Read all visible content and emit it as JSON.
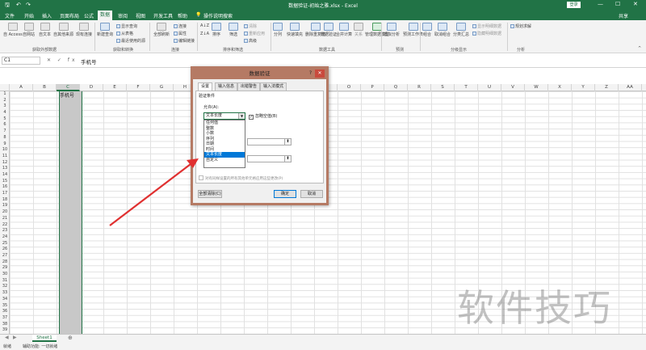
{
  "titlebar": {
    "title": "数据验证-初始之雅.xlsx  -  Excel",
    "login": "登录",
    "qa_save": "🖫",
    "qa_undo": "↶",
    "qa_redo": "↷",
    "win_min": "—",
    "win_max": "☐",
    "win_close": "✕"
  },
  "menu": {
    "tabs": [
      "文件",
      "开始",
      "插入",
      "页面布局",
      "公式",
      "数据",
      "审阅",
      "视图",
      "开发工具",
      "帮助",
      "操作说明搜索"
    ],
    "active": "数据",
    "share": "共享"
  },
  "ribbon": {
    "get_external": {
      "items": [
        "自 Access",
        "自网站",
        "自文本",
        "自其他来源",
        "现有连接"
      ],
      "label": "获取外部数据"
    },
    "transform": {
      "new_query": "新建查询",
      "small": [
        "显示查询",
        "从表格",
        "最近使用的源"
      ],
      "label": "获取和转换"
    },
    "connections": {
      "refresh": "全部刷新",
      "small": [
        "连接",
        "属性",
        "编辑链接"
      ],
      "label": "连接"
    },
    "sort_filter": {
      "sort": "排序",
      "filter": "筛选",
      "small": [
        "清除",
        "重新应用",
        "高级"
      ],
      "label": "排序和筛选"
    },
    "data_tools": {
      "items": [
        "分列",
        "快速填充",
        "删除重复值",
        "数据验证",
        "合并计算",
        "关系",
        "管理数据模型"
      ],
      "label": "数据工具"
    },
    "forecast": {
      "items": [
        "模拟分析",
        "预测工作表"
      ],
      "label": "预测"
    },
    "outline": {
      "items": [
        "组合",
        "取消组合",
        "分类汇总"
      ],
      "small": [
        "显示明细数据",
        "隐藏明细数据"
      ],
      "label": "分级显示"
    },
    "analysis": {
      "item": "规划求解",
      "label": "分析"
    }
  },
  "formula_bar": {
    "namebox": "C1",
    "icons": "✕ ✓ fx",
    "value": "手机号"
  },
  "grid": {
    "columns": [
      "A",
      "B",
      "C",
      "D",
      "E",
      "F",
      "G",
      "H",
      "I",
      "J",
      "K",
      "L",
      "M",
      "N",
      "O",
      "P",
      "Q",
      "R",
      "S",
      "T",
      "U",
      "V",
      "W",
      "X",
      "Y",
      "Z",
      "AA"
    ],
    "rows": [
      "1",
      "2",
      "3",
      "4",
      "5",
      "6",
      "7",
      "8",
      "9",
      "10",
      "11",
      "12",
      "13",
      "14",
      "15",
      "16",
      "17",
      "18",
      "19",
      "20",
      "21",
      "22",
      "23",
      "24",
      "25",
      "26",
      "27",
      "28",
      "29",
      "30",
      "31",
      "32",
      "33",
      "34",
      "35",
      "36",
      "37",
      "38",
      "39"
    ],
    "c1_value": "手机号"
  },
  "sheets": {
    "tab": "Sheet1",
    "add": "⊕"
  },
  "status": {
    "text": "就绪",
    "accessibility": "辅助功能: 一切就绪"
  },
  "dialog": {
    "title": "数据验证",
    "help": "?",
    "close": "✕",
    "tabs": [
      "设置",
      "输入信息",
      "出错警告",
      "输入法模式"
    ],
    "criteria_label": "验证条件",
    "allow_label": "允许(A):",
    "allow_value": "文本长度",
    "ignore_blank": "忽略空值(B)",
    "options": [
      "任何值",
      "整数",
      "小数",
      "序列",
      "日期",
      "时间",
      "文本长度",
      "自定义"
    ],
    "selected_option": "文本长度",
    "ref_pick": "⬆",
    "apply_all": "对有同样设置的所有其他单元格应用这些更改(P)",
    "clear_all": "全部清除(C)",
    "ok": "确定",
    "cancel": "取消"
  },
  "watermark": "软件技巧",
  "colors": {
    "excel_green": "#217346",
    "dialog_border": "#b57a64",
    "arrow": "#e03030"
  }
}
